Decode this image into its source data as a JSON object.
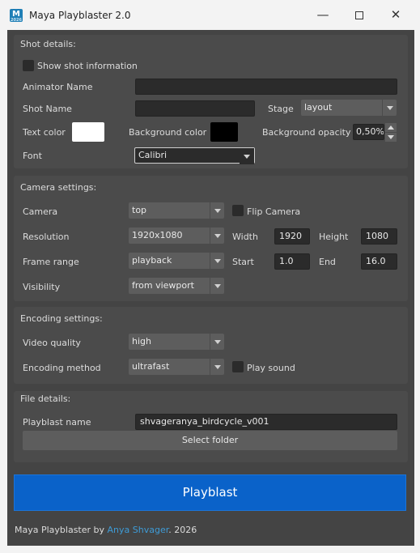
{
  "window": {
    "title": "Maya Playblaster 2.0",
    "icon_letter": "M",
    "icon_sub": "2026",
    "minimize": "—",
    "close": "✕"
  },
  "shot_details": {
    "title": "Shot details:",
    "show_shot_info_label": "Show shot information",
    "show_shot_info_checked": false,
    "animator_label": "Animator Name",
    "animator_value": "",
    "shot_label": "Shot Name",
    "shot_value": "",
    "stage_label": "Stage",
    "stage_value": "layout",
    "text_color_label": "Text color",
    "text_color": "#ffffff",
    "bg_color_label": "Background color",
    "bg_color": "#000000",
    "bg_opacity_label": "Background opacity",
    "bg_opacity_value": "0,50%",
    "font_label": "Font",
    "font_value": "Calibri"
  },
  "camera_settings": {
    "title": "Camera settings:",
    "camera_label": "Camera",
    "camera_value": "top",
    "flip_label": "Flip Camera",
    "flip_checked": false,
    "resolution_label": "Resolution",
    "resolution_value": "1920x1080",
    "width_label": "Width",
    "width_value": "1920",
    "height_label": "Height",
    "height_value": "1080",
    "frame_range_label": "Frame range",
    "frame_range_value": "playback",
    "start_label": "Start",
    "start_value": "1.0",
    "end_label": "End",
    "end_value": "16.0",
    "visibility_label": "Visibility",
    "visibility_value": "from viewport"
  },
  "encoding_settings": {
    "title": "Encoding settings:",
    "quality_label": "Video quality",
    "quality_value": "high",
    "method_label": "Encoding method",
    "method_value": "ultrafast",
    "sound_label": "Play sound",
    "sound_checked": false
  },
  "file_details": {
    "title": "File details:",
    "name_label": "Playblast name",
    "name_value": "shvageranya_birdcycle_v001",
    "select_folder_label": "Select folder"
  },
  "playblast_button": "Playblast",
  "footer": {
    "prefix": "Maya Playblaster by ",
    "author": "Anya Shvager",
    "suffix": ". 2026"
  },
  "colors": {
    "accent": "#0a62c9",
    "link": "#3e9bd6",
    "panel": "#444444",
    "group": "#4b4b4b"
  }
}
